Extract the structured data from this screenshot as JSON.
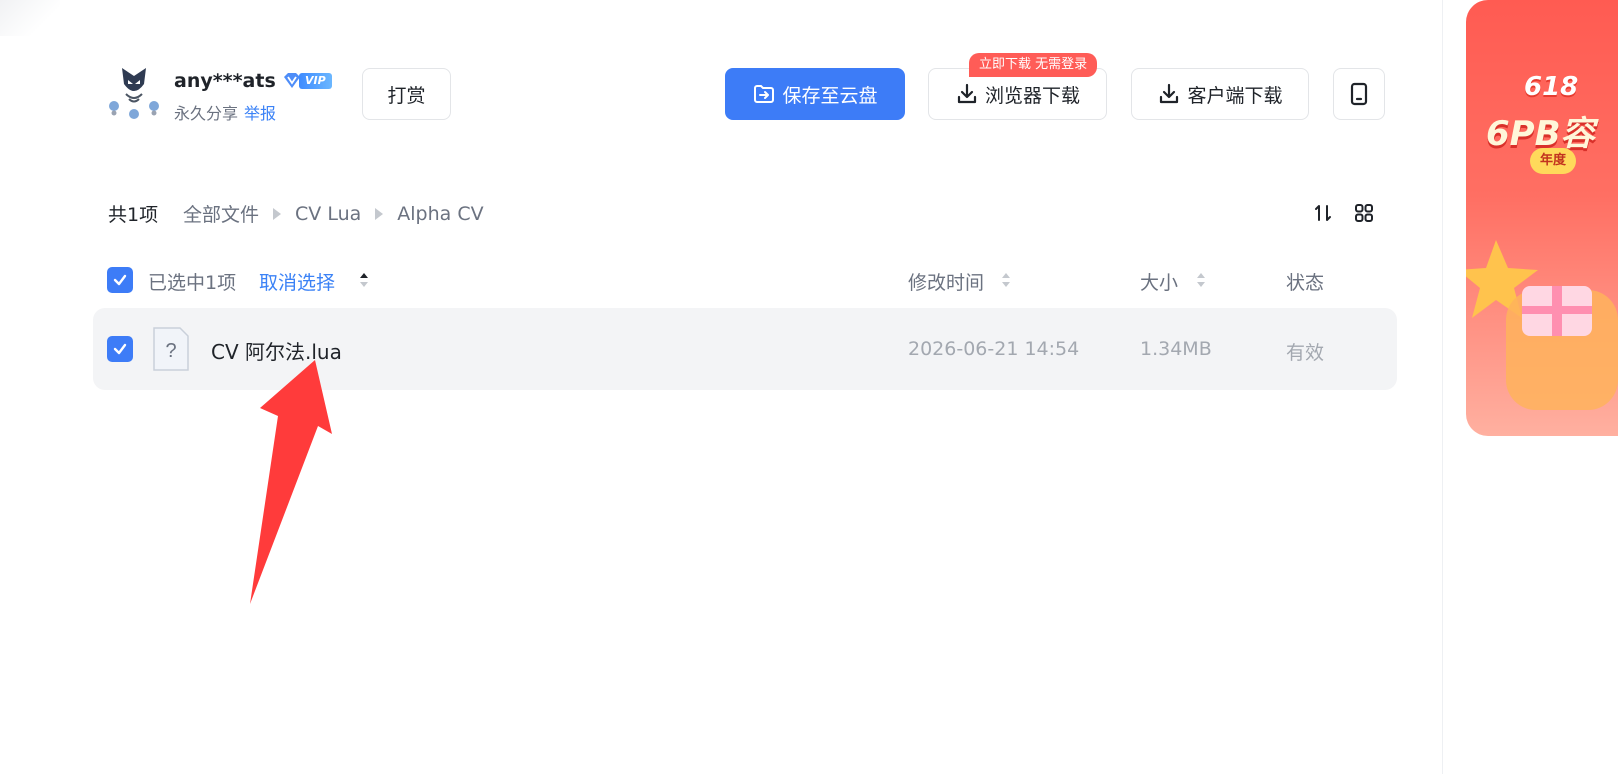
{
  "header": {
    "username": "any***ats",
    "vip_label": "VIP",
    "share_status": "永久分享",
    "report_label": "举报",
    "tip_button": "打赏",
    "save_button": "保存至云盘",
    "browser_download_button": "浏览器下载",
    "browser_download_tag": "立即下载 无需登录",
    "client_download_button": "客户端下载"
  },
  "breadcrumb": {
    "count": "共1项",
    "items": [
      "全部文件",
      "CV Lua",
      "Alpha CV"
    ]
  },
  "table": {
    "selected_text": "已选中1项",
    "cancel_selection": "取消选择",
    "columns": {
      "modified": "修改时间",
      "size": "大小",
      "status": "状态"
    },
    "rows": [
      {
        "name": "CV 阿尔法.lua",
        "modified": "2026-06-21 14:54",
        "size": "1.34MB",
        "status": "有效",
        "selected": true
      }
    ]
  },
  "banner": {
    "line1": "618",
    "line2": "6PB容",
    "pill": "年度"
  },
  "colors": {
    "primary": "#3d7cf7",
    "promo": "#ff5c57",
    "row_bg": "#f3f4f6",
    "annotation_arrow": "#ff3b3b"
  }
}
